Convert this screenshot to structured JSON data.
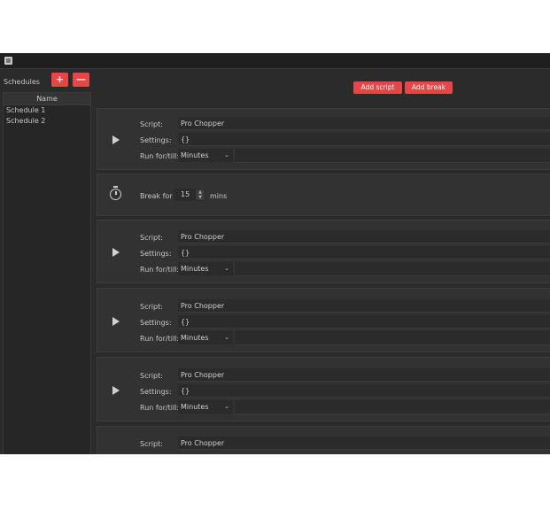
{
  "schedules": {
    "label": "Schedules",
    "add_label": "+",
    "remove_label": "—",
    "column_header": "Name",
    "items": [
      "Schedule 1",
      "Schedule 2"
    ]
  },
  "toolbar": {
    "add_script": "Add script",
    "add_break": "Add break"
  },
  "labels": {
    "script": "Script:",
    "settings": "Settings:",
    "run_for": "Run for/till:"
  },
  "entries": [
    {
      "type": "script",
      "script": "Pro Chopper",
      "settings": "{}",
      "run_for": "Minutes"
    },
    {
      "type": "break",
      "label": "Break for",
      "value": "15",
      "unit": "mins"
    },
    {
      "type": "script",
      "script": "Pro Chopper",
      "settings": "{}",
      "run_for": "Minutes"
    },
    {
      "type": "script",
      "script": "Pro Chopper",
      "settings": "{}",
      "run_for": "Minutes"
    },
    {
      "type": "script",
      "script": "Pro Chopper",
      "settings": "{}",
      "run_for": "Minutes"
    },
    {
      "type": "script",
      "script": "Pro Chopper"
    }
  ],
  "colors": {
    "accent": "#e64646",
    "background": "#2b2b2b",
    "panel": "#323232"
  }
}
